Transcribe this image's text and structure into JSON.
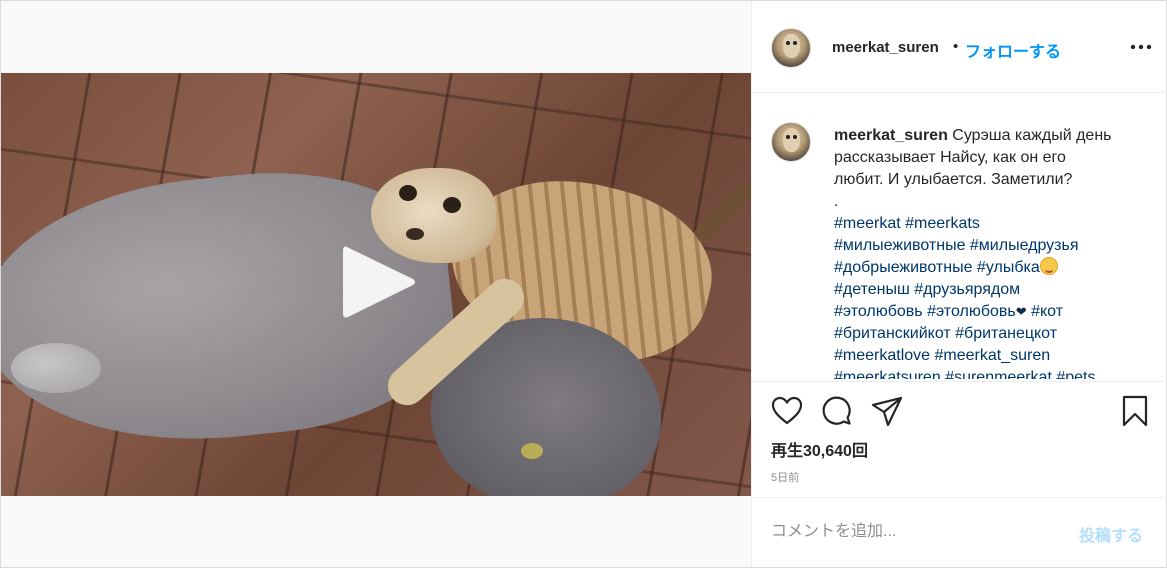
{
  "header": {
    "username": "meerkat_suren",
    "separator": "•",
    "follow_label": "フォローする",
    "more_icon": "more-options-icon"
  },
  "caption": {
    "username": "meerkat_suren",
    "lines": [
      "Сурэша каждый день",
      "рассказывает Найсу, как он его",
      "любит. И улыбается. Заметили?",
      ".",
      "#meerkat #meerkats",
      "#милыеживотные #милыедрузья",
      "#добрыеживотные #улыбка",
      "#детеныш #друзьярядом",
      "#этолюбовь #этолюбовь",
      "#кот",
      "#британскийкот #британецкот",
      "#meerkatlove #meerkat_suren",
      "#meerkatsuren #surenmeerkat #pets"
    ]
  },
  "actions": {
    "like_icon": "heart-icon",
    "comment_icon": "comment-icon",
    "share_icon": "share-icon",
    "save_icon": "bookmark-icon"
  },
  "stats": {
    "views_label": "再生30,640回",
    "time_ago": "5日前"
  },
  "comment_box": {
    "placeholder": "コメントを追加...",
    "post_label": "投稿する"
  },
  "colors": {
    "link": "#0095f6",
    "hashtag": "#00376b",
    "post_disabled": "#b2dffc"
  }
}
